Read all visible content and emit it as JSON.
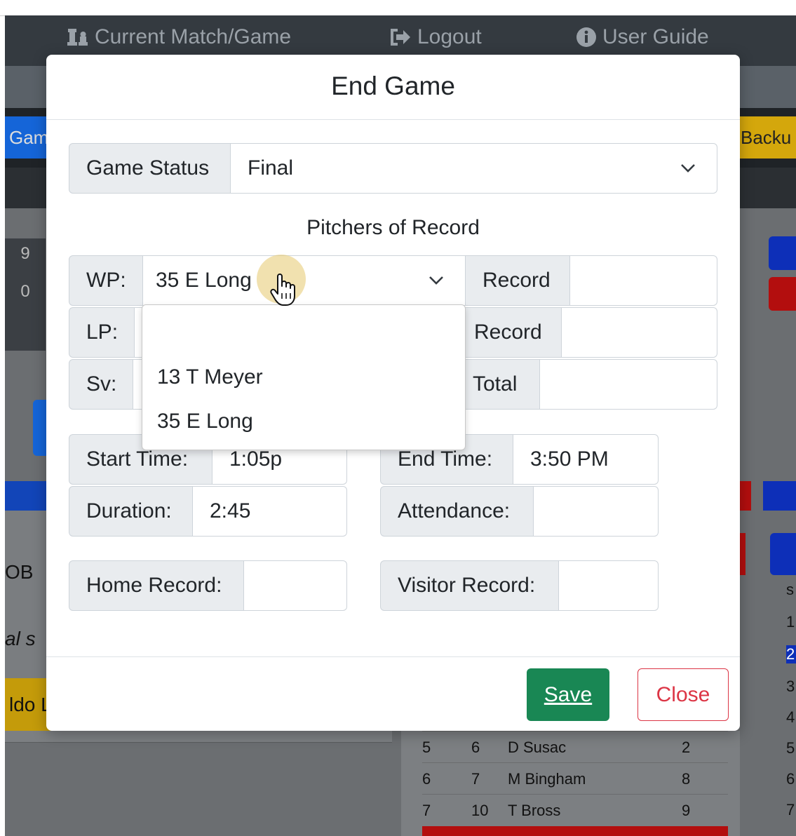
{
  "background": {
    "nav": {
      "current_match": "Current Match/Game",
      "logout": "Logout",
      "user_guide": "User Guide"
    },
    "left_button": "Gam",
    "backup_button": "Backu",
    "scores": [
      "9",
      "0"
    ],
    "left_texts": [
      "OB",
      "al s",
      "ldo L"
    ],
    "right_numbers": [
      "s",
      "1",
      "2",
      "3",
      "4",
      "5",
      "6",
      "7"
    ],
    "roster_rows": [
      {
        "order": "5",
        "num": "6",
        "name": "D Susac",
        "pos": "2"
      },
      {
        "order": "6",
        "num": "7",
        "name": "M Bingham",
        "pos": "8"
      },
      {
        "order": "7",
        "num": "10",
        "name": "T Bross",
        "pos": "9"
      }
    ]
  },
  "modal": {
    "title": "End Game",
    "game_status": {
      "label": "Game Status",
      "value": "Final"
    },
    "pitchers_title": "Pitchers of Record",
    "wp": {
      "label": "WP:",
      "value": "35 E Long",
      "record_label": "Record",
      "record_value": ""
    },
    "lp": {
      "label": "LP:",
      "value": "",
      "record_label": "Record",
      "record_value": ""
    },
    "sv": {
      "label": "Sv:",
      "value": "",
      "total_label": "Total",
      "total_value": ""
    },
    "dropdown_options": [
      "",
      "13 T Meyer",
      "35 E Long"
    ],
    "start_time": {
      "label": "Start Time:",
      "value": "1:05p"
    },
    "end_time": {
      "label": "End Time:",
      "value": "3:50 PM"
    },
    "duration": {
      "label": "Duration:",
      "value": "2:45"
    },
    "attendance": {
      "label": "Attendance:",
      "value": ""
    },
    "home_record": {
      "label": "Home Record:",
      "value": ""
    },
    "visitor_record": {
      "label": "Visitor Record:",
      "value": ""
    },
    "save_label": "Save",
    "close_label": "Close"
  },
  "colors": {
    "save": "#198754",
    "close": "#dc3545",
    "navbar": "#343a40"
  }
}
